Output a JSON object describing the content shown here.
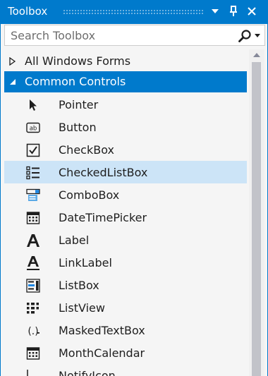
{
  "window": {
    "title": "Toolbox"
  },
  "search": {
    "placeholder": "Search Toolbox"
  },
  "groups": [
    {
      "label": "All Windows Forms",
      "expanded": false
    },
    {
      "label": "Common Controls",
      "expanded": true
    }
  ],
  "items": [
    {
      "label": "Pointer",
      "icon": "pointer-icon"
    },
    {
      "label": "Button",
      "icon": "button-icon"
    },
    {
      "label": "CheckBox",
      "icon": "checkbox-icon"
    },
    {
      "label": "CheckedListBox",
      "icon": "checkedlistbox-icon"
    },
    {
      "label": "ComboBox",
      "icon": "combobox-icon"
    },
    {
      "label": "DateTimePicker",
      "icon": "datetimepicker-icon"
    },
    {
      "label": "Label",
      "icon": "label-icon"
    },
    {
      "label": "LinkLabel",
      "icon": "linklabel-icon"
    },
    {
      "label": "ListBox",
      "icon": "listbox-icon"
    },
    {
      "label": "ListView",
      "icon": "listview-icon"
    },
    {
      "label": "MaskedTextBox",
      "icon": "maskedtextbox-icon"
    },
    {
      "label": "MonthCalendar",
      "icon": "monthcalendar-icon"
    },
    {
      "label": "NotifyIcon",
      "icon": "notifyicon-icon"
    }
  ],
  "colors": {
    "accent": "#007acc",
    "selected_row": "#cce4f7"
  }
}
